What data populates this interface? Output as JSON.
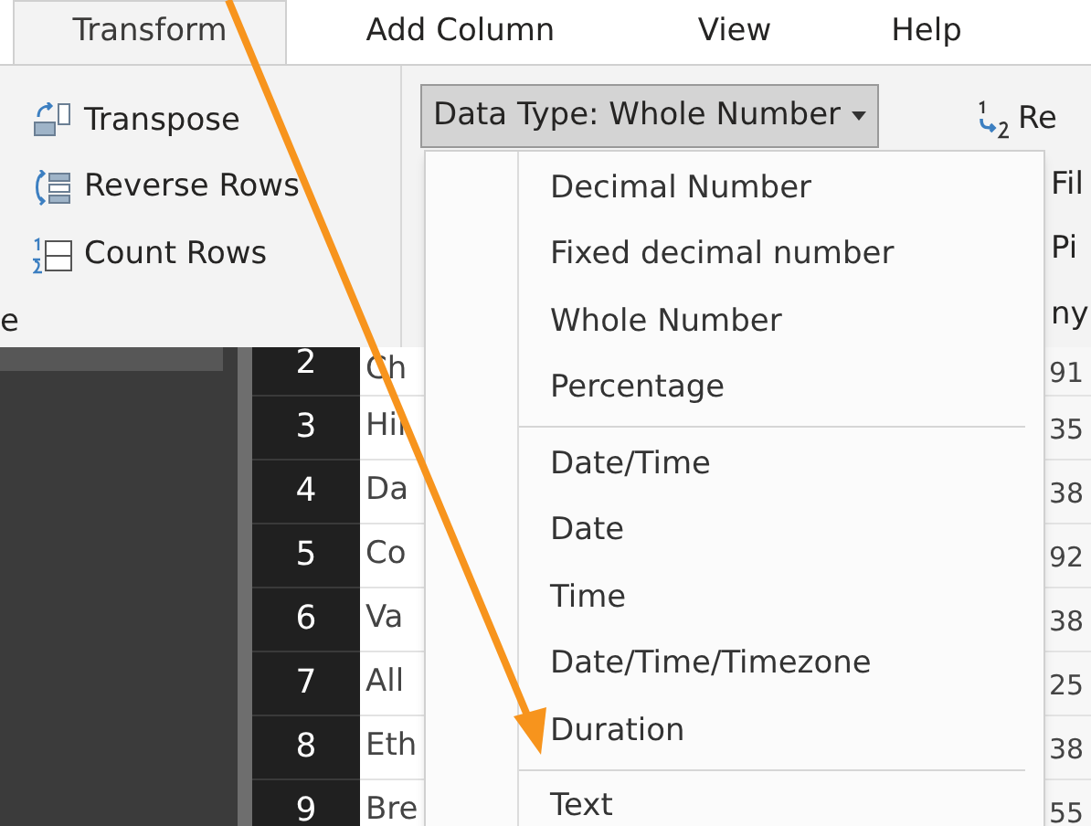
{
  "tabs": [
    {
      "label": "Transform",
      "selected": true
    },
    {
      "label": "Add Column",
      "selected": false
    },
    {
      "label": "View",
      "selected": false
    },
    {
      "label": "Help",
      "selected": false
    }
  ],
  "ribbon": {
    "left_group": [
      {
        "kind": "transpose",
        "label": "Transpose"
      },
      {
        "kind": "reverse",
        "label": "Reverse Rows"
      },
      {
        "kind": "count",
        "label": "Count Rows"
      }
    ],
    "left_group_label": "e",
    "data_type_button": {
      "label": "Data Type: Whole Number",
      "expanded": true
    },
    "right_group": [
      {
        "kind": "index",
        "label": "Re"
      },
      {
        "kind": "plain",
        "label": "Fil"
      },
      {
        "kind": "plain",
        "label": "Pi"
      },
      {
        "kind": "plain",
        "label": "ny"
      }
    ]
  },
  "data_type_menu": [
    {
      "label": "Decimal Number",
      "separator_before": false
    },
    {
      "label": "Fixed decimal number",
      "separator_before": false
    },
    {
      "label": "Whole Number",
      "separator_before": false
    },
    {
      "label": "Percentage",
      "separator_before": false
    },
    {
      "label": "Date/Time",
      "separator_before": true
    },
    {
      "label": "Date",
      "separator_before": false
    },
    {
      "label": "Time",
      "separator_before": false
    },
    {
      "label": "Date/Time/Timezone",
      "separator_before": false
    },
    {
      "label": "Duration",
      "separator_before": false
    },
    {
      "label": "Text",
      "separator_before": true
    }
  ],
  "table": {
    "rows": [
      {
        "row_number": "2",
        "column_1": "Ch",
        "column_2": "91"
      },
      {
        "row_number": "3",
        "column_1": "Hil",
        "column_2": "35"
      },
      {
        "row_number": "4",
        "column_1": "Da",
        "column_2": "38"
      },
      {
        "row_number": "5",
        "column_1": "Co",
        "column_2": "92"
      },
      {
        "row_number": "6",
        "column_1": "Va",
        "column_2": "38"
      },
      {
        "row_number": "7",
        "column_1": "All",
        "column_2": "25"
      },
      {
        "row_number": "8",
        "column_1": "Eth",
        "column_2": "38"
      },
      {
        "row_number": "9",
        "column_1": "Bre",
        "column_2": "55"
      }
    ]
  }
}
